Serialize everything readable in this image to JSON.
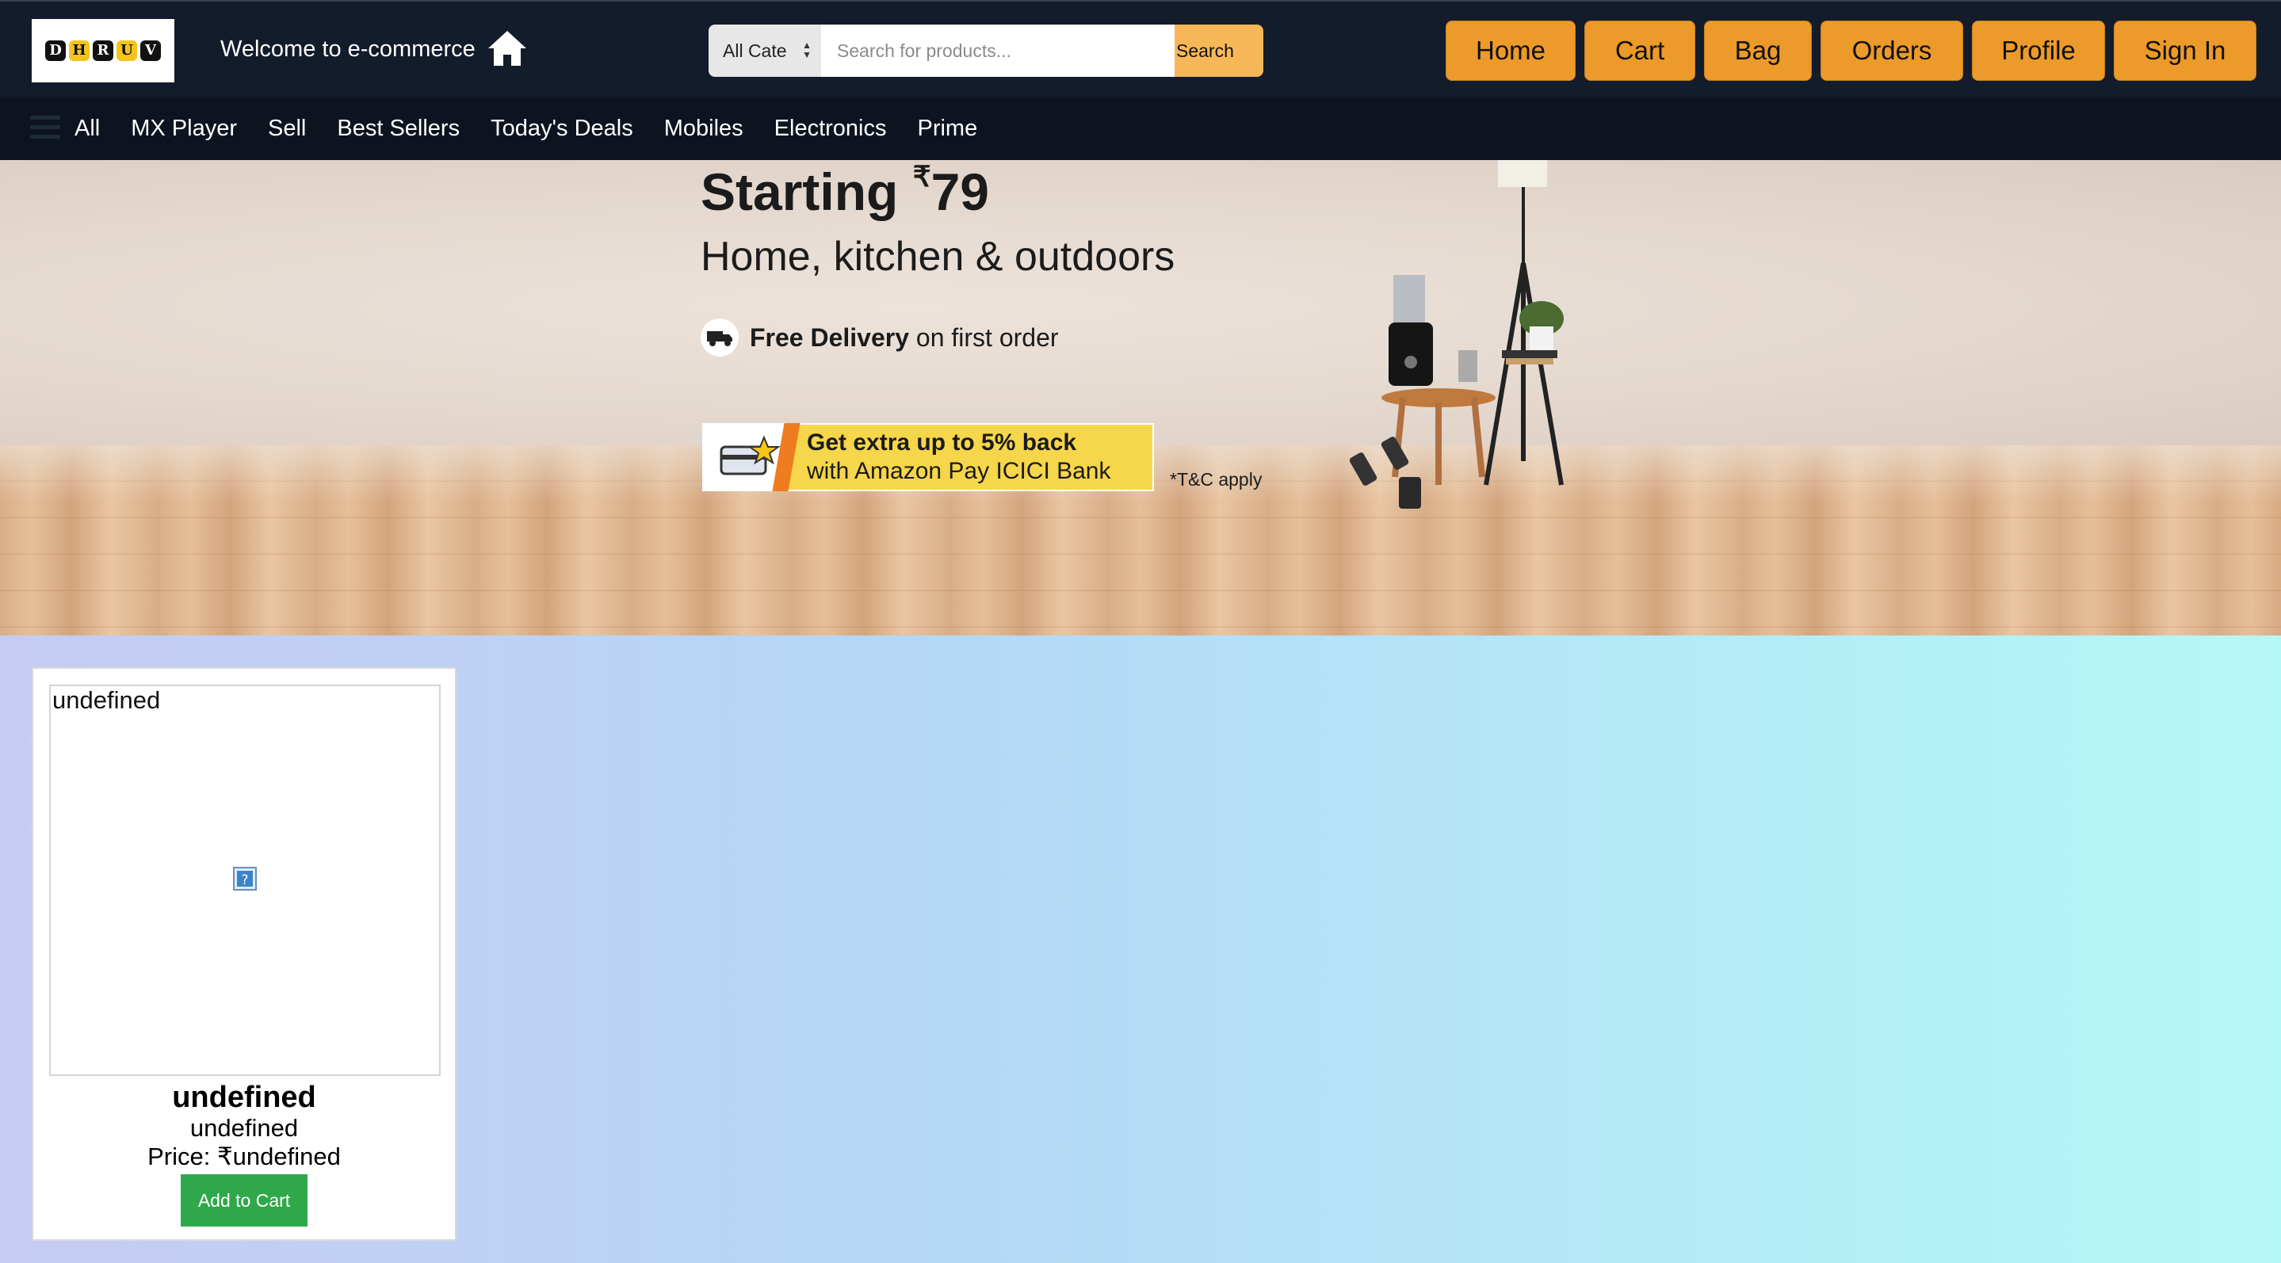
{
  "header": {
    "logo_letters": [
      "D",
      "H",
      "R",
      "U",
      "V"
    ],
    "welcome": "Welcome to e-commerce",
    "home_icon": "home-icon",
    "search": {
      "category": "All Cate",
      "placeholder": "Search for products...",
      "button": "Search"
    },
    "nav_buttons": [
      "Home",
      "Cart",
      "Bag",
      "Orders",
      "Profile",
      "Sign In"
    ],
    "colors": {
      "bar": "#131c2b",
      "button": "#ec9a2a",
      "search_button": "#f7b758"
    }
  },
  "subnav": {
    "menu_icon": "hamburger-icon",
    "items": [
      "All",
      "MX Player",
      "Sell",
      "Best Sellers",
      "Today's Deals",
      "Mobiles",
      "Electronics",
      "Prime"
    ]
  },
  "banner": {
    "title_prefix": "Starting ",
    "currency": "₹",
    "price": "79",
    "subtitle": "Home, kitchen & outdoors",
    "delivery_bold": "Free Delivery",
    "delivery_rest": "on first order",
    "promo_line1": "Get extra up to 5% back",
    "promo_line2": "with Amazon Pay ICICI Bank",
    "tc": "*T&C apply"
  },
  "product": {
    "image_alt": "undefined",
    "name": "undefined",
    "description": "undefined",
    "price": "Price: ₹undefined",
    "button": "Add to Cart",
    "button_color": "#2fa84a"
  }
}
